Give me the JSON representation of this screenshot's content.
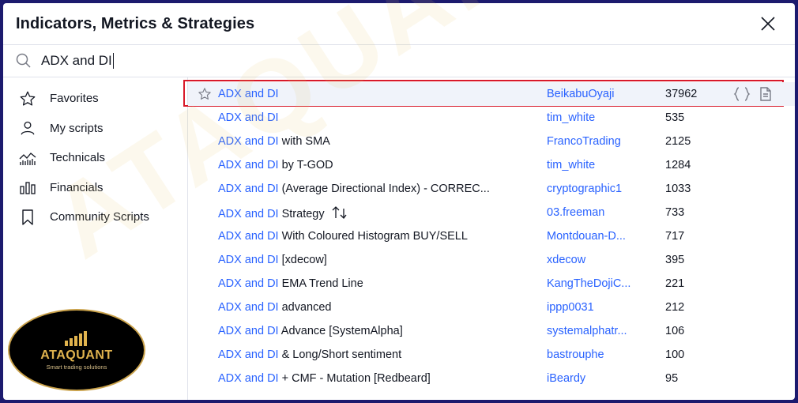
{
  "dialog": {
    "title": "Indicators, Metrics & Strategies"
  },
  "search": {
    "value": "ADX and DI"
  },
  "sidebar": {
    "items": [
      {
        "label": "Favorites",
        "icon": "star-icon"
      },
      {
        "label": "My scripts",
        "icon": "user-icon"
      },
      {
        "label": "Technicals",
        "icon": "technicals-chart-icon"
      },
      {
        "label": "Financials",
        "icon": "financials-bars-icon"
      },
      {
        "label": "Community Scripts",
        "icon": "bookmark-icon"
      }
    ]
  },
  "results": [
    {
      "keyword": "ADX and DI",
      "rest": "",
      "author": "BeikabuOyaji",
      "likes": "37962"
    },
    {
      "keyword": "ADX and DI",
      "rest": "",
      "author": "tim_white",
      "likes": "535"
    },
    {
      "keyword": "ADX and DI",
      "rest": " with SMA",
      "author": "FrancoTrading",
      "likes": "2125"
    },
    {
      "keyword": "ADX and DI",
      "rest": " by T-GOD",
      "author": "tim_white",
      "likes": "1284"
    },
    {
      "keyword": "ADX and DI",
      "rest": " (Average Directional Index) - CORREC...",
      "author": "cryptographic1",
      "likes": "1033"
    },
    {
      "keyword": "ADX and DI",
      "rest": " Strategy",
      "author": "03.freeman",
      "likes": "733"
    },
    {
      "keyword": "ADX and DI",
      "rest": " With Coloured Histogram BUY/SELL",
      "author": "Montdouan-D...",
      "likes": "717"
    },
    {
      "keyword": "ADX and DI",
      "rest": " [xdecow]",
      "author": "xdecow",
      "likes": "395"
    },
    {
      "keyword": "ADX and DI",
      "rest": " EMA Trend Line",
      "author": "KangTheDojiC...",
      "likes": "221"
    },
    {
      "keyword": "ADX and DI",
      "rest": " advanced",
      "author": "ippp0031",
      "likes": "212"
    },
    {
      "keyword": "ADX and DI",
      "rest": " Advance [SystemAlpha]",
      "author": "systemalphatr...",
      "likes": "106"
    },
    {
      "keyword": "ADX and DI",
      "rest": " & Long/Short sentiment",
      "author": "bastrouphe",
      "likes": "100"
    },
    {
      "keyword": "ADX and DI",
      "rest": " + CMF - Mutation [Redbeard]",
      "author": "iBeardy",
      "likes": "95"
    }
  ],
  "logo": {
    "name": "ATAQUANT",
    "tagline": "Smart trading solutions"
  },
  "watermark": {
    "text": "ATAQUANT"
  },
  "colors": {
    "accent": "#2962ff",
    "highlight_border": "#d8192a",
    "background": "#1c1a6e",
    "logo_gold": "#e0b34e"
  }
}
